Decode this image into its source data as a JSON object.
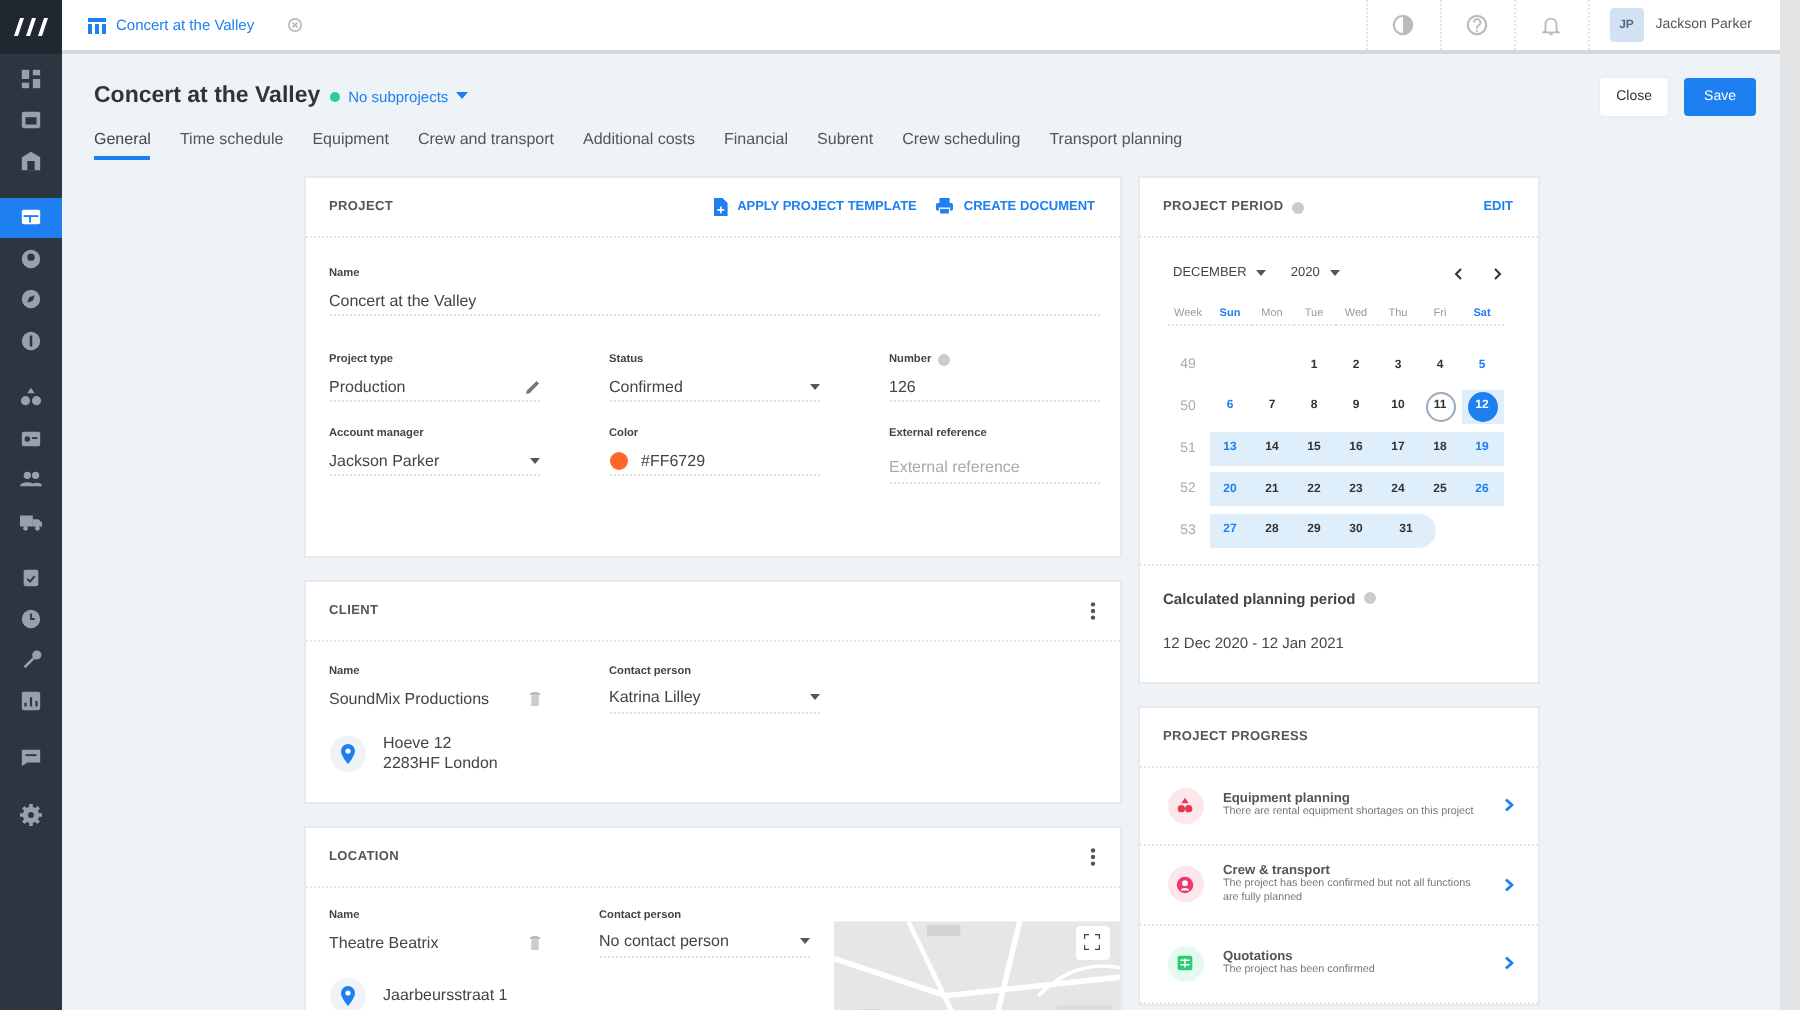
{
  "sidebar": {
    "groups": [
      {
        "items": [
          {
            "selected": false
          },
          {
            "selected": false
          },
          {
            "selected": false
          }
        ]
      },
      {
        "items": [
          {
            "selected": true
          },
          {
            "selected": false
          },
          {
            "selected": false
          },
          {
            "selected": false
          }
        ]
      },
      {
        "items": [
          {
            "selected": false
          },
          {
            "selected": false
          },
          {
            "selected": false
          },
          {
            "selected": false
          }
        ]
      },
      {
        "items": [
          {
            "selected": false
          },
          {
            "selected": false
          },
          {
            "selected": false
          },
          {
            "selected": false
          }
        ]
      },
      {
        "items": [
          {
            "selected": false
          }
        ]
      },
      {
        "items": [
          {
            "selected": false
          }
        ]
      }
    ]
  },
  "top_bar": {
    "tab": {
      "title": "Concert at the Valley"
    },
    "user": {
      "initials": "JP",
      "name": "Jackson Parker"
    }
  },
  "header": {
    "title": "Concert at the Valley",
    "subprojects": "No subprojects",
    "buttons": [
      {
        "label": "Close",
        "kind": "secondary"
      },
      {
        "label": "Save",
        "kind": "primary"
      }
    ]
  },
  "tabs": [
    {
      "label": "General",
      "selected": true
    },
    {
      "label": "Time schedule",
      "selected": false
    },
    {
      "label": "Equipment",
      "selected": false
    },
    {
      "label": "Crew and transport",
      "selected": false
    },
    {
      "label": "Additional costs",
      "selected": false
    },
    {
      "label": "Financial",
      "selected": false
    },
    {
      "label": "Subrent",
      "selected": false
    },
    {
      "label": "Crew scheduling",
      "selected": false
    },
    {
      "label": "Transport planning",
      "selected": false
    }
  ],
  "project": {
    "title": "PROJECT",
    "actions": [
      {
        "label": "APPLY PROJECT TEMPLATE",
        "kind": "template"
      },
      {
        "label": "CREATE DOCUMENT",
        "kind": "print"
      }
    ],
    "fields": [
      {
        "label": "Name",
        "value": "Concert at the Valley",
        "kind": "wide"
      },
      {
        "label": "Project type",
        "value": "Production",
        "kind": "edit"
      },
      {
        "label": "Status",
        "value": "Confirmed",
        "kind": "select"
      },
      {
        "label": "Number",
        "value": "126",
        "kind": "info"
      },
      {
        "label": "Account manager",
        "value": "Jackson Parker",
        "kind": "select"
      },
      {
        "label": "Color",
        "value": "#FF6729",
        "kind": "color",
        "color": "#ff6729"
      },
      {
        "label": "External reference",
        "placeholder": "External reference",
        "kind": "input"
      }
    ]
  },
  "client": {
    "title": "CLIENT",
    "name_field": {
      "label": "Name",
      "value": "SoundMix Productions"
    },
    "contact_field": {
      "label": "Contact person",
      "value": "Katrina Lilley"
    },
    "address": [
      "Hoeve 12",
      "2283HF London"
    ]
  },
  "location": {
    "title": "LOCATION",
    "name_field": {
      "label": "Name",
      "value": "Theatre Beatrix"
    },
    "contact_field": {
      "label": "Contact person",
      "value": "No contact person"
    },
    "address": [
      "Jaarbeursstraat 1"
    ],
    "map": {
      "kind": "picture"
    }
  },
  "period": {
    "title": "PROJECT PERIOD",
    "action": "EDIT",
    "month": "DECEMBER",
    "year": "2020",
    "weekdays": [
      {
        "label": "Week",
        "weekend": false
      },
      {
        "label": "Sun",
        "weekend": true
      },
      {
        "label": "Mon",
        "weekend": false
      },
      {
        "label": "Tue",
        "weekend": false
      },
      {
        "label": "Wed",
        "weekend": false
      },
      {
        "label": "Thu",
        "weekend": false
      },
      {
        "label": "Fri",
        "weekend": false
      },
      {
        "label": "Sat",
        "weekend": true
      }
    ],
    "weeks": [
      {
        "number": "49",
        "days": [
          {
            "kind": "blank"
          },
          {
            "kind": "blank"
          },
          {
            "kind": "day",
            "label": "1",
            "selected": false,
            "in_period": false,
            "today": false
          },
          {
            "kind": "day",
            "label": "2",
            "selected": false,
            "in_period": false,
            "today": false
          },
          {
            "kind": "day",
            "label": "3",
            "selected": false,
            "in_period": false,
            "today": false
          },
          {
            "kind": "day",
            "label": "4",
            "selected": false,
            "in_period": false,
            "today": false
          },
          {
            "kind": "day",
            "label": "5",
            "selected": false,
            "in_period": false,
            "today": false
          }
        ]
      },
      {
        "number": "50",
        "days": [
          {
            "kind": "day",
            "label": "6",
            "selected": false,
            "in_period": false,
            "today": false
          },
          {
            "kind": "day",
            "label": "7",
            "selected": false,
            "in_period": false,
            "today": false
          },
          {
            "kind": "day",
            "label": "8",
            "selected": false,
            "in_period": false,
            "today": false
          },
          {
            "kind": "day",
            "label": "9",
            "selected": false,
            "in_period": false,
            "today": false
          },
          {
            "kind": "day",
            "label": "10",
            "selected": false,
            "in_period": false,
            "today": false
          },
          {
            "kind": "day",
            "label": "11",
            "selected": false,
            "in_period": false,
            "today": true
          },
          {
            "kind": "day",
            "label": "12",
            "selected": true,
            "in_period": true,
            "today": false
          }
        ]
      },
      {
        "number": "51",
        "days": [
          {
            "kind": "day",
            "label": "13",
            "selected": false,
            "in_period": true,
            "today": false
          },
          {
            "kind": "day",
            "label": "14",
            "selected": false,
            "in_period": true,
            "today": false
          },
          {
            "kind": "day",
            "label": "15",
            "selected": false,
            "in_period": true,
            "today": false
          },
          {
            "kind": "day",
            "label": "16",
            "selected": false,
            "in_period": true,
            "today": false
          },
          {
            "kind": "day",
            "label": "17",
            "selected": false,
            "in_period": true,
            "today": false
          },
          {
            "kind": "day",
            "label": "18",
            "selected": false,
            "in_period": true,
            "today": false
          },
          {
            "kind": "day",
            "label": "19",
            "selected": false,
            "in_period": true,
            "today": false
          }
        ]
      },
      {
        "number": "52",
        "days": [
          {
            "kind": "day",
            "label": "20",
            "selected": false,
            "in_period": true,
            "today": false
          },
          {
            "kind": "day",
            "label": "21",
            "selected": false,
            "in_period": true,
            "today": false
          },
          {
            "kind": "day",
            "label": "22",
            "selected": false,
            "in_period": true,
            "today": false
          },
          {
            "kind": "day",
            "label": "23",
            "selected": false,
            "in_period": true,
            "today": false
          },
          {
            "kind": "day",
            "label": "24",
            "selected": false,
            "in_period": true,
            "today": false
          },
          {
            "kind": "day",
            "label": "25",
            "selected": false,
            "in_period": true,
            "today": false
          },
          {
            "kind": "day",
            "label": "26",
            "selected": false,
            "in_period": true,
            "today": false
          }
        ]
      },
      {
        "number": "53",
        "days": [
          {
            "kind": "day",
            "label": "27",
            "selected": false,
            "in_period": true,
            "today": false
          },
          {
            "kind": "day",
            "label": "28",
            "selected": false,
            "in_period": true,
            "today": false
          },
          {
            "kind": "day",
            "label": "29",
            "selected": false,
            "in_period": true,
            "today": false
          },
          {
            "kind": "day",
            "label": "30",
            "selected": false,
            "in_period": true,
            "today": false
          },
          {
            "kind": "day",
            "label": "31",
            "selected": false,
            "in_period": true,
            "today": false
          },
          {
            "kind": "blank"
          },
          {
            "kind": "blank"
          }
        ]
      }
    ]
  },
  "planning": {
    "title": "Calculated planning period",
    "value": "12 Dec 2020 - 12 Jan 2021"
  },
  "progress": {
    "title": "PROJECT PROGRESS",
    "items": [
      {
        "kind": "equipment",
        "title": "Equipment planning",
        "description": "There are rental equipment shortages on this project",
        "color": "#e8384f"
      },
      {
        "kind": "crew",
        "title": "Crew & transport",
        "description": "The project has been confirmed but not all functions are fully planned",
        "color": "#ee3a6a"
      },
      {
        "kind": "quotation",
        "title": "Quotations",
        "description": "The project has been confirmed",
        "color": "#2ecc71"
      }
    ]
  }
}
